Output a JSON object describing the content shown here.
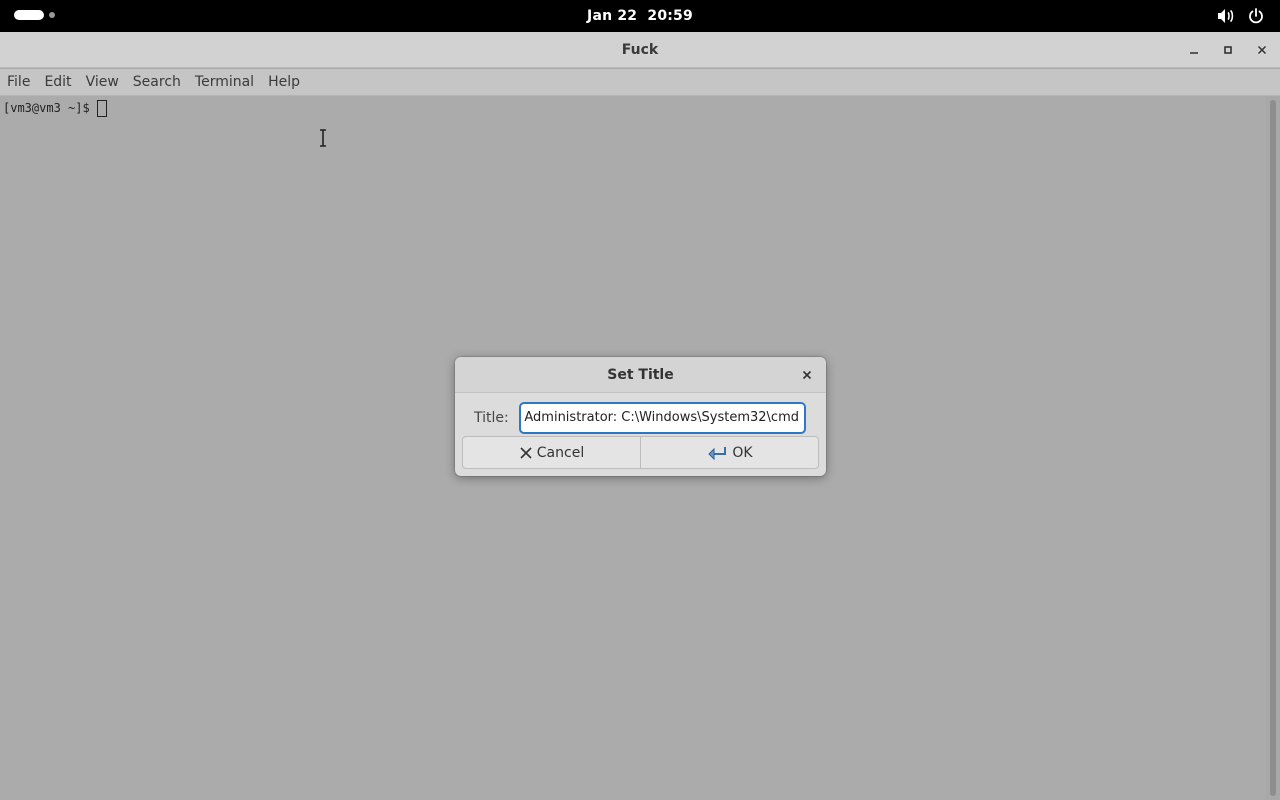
{
  "topbar": {
    "date": "Jan 22",
    "time": "20:59",
    "icons": [
      "activities-indicator",
      "volume-icon",
      "power-icon"
    ]
  },
  "window": {
    "title": "Fuck",
    "menu": [
      "File",
      "Edit",
      "View",
      "Search",
      "Terminal",
      "Help"
    ],
    "prompt": "[vm3@vm3 ~]$"
  },
  "dialog": {
    "title": "Set Title",
    "label": "Title:",
    "value": "Administrator: C:\\Windows\\System32\\cmd",
    "cancel_label": "Cancel",
    "ok_label": "OK"
  },
  "colors": {
    "accent": "#2f77c4",
    "terminal_bg": "#ababab",
    "topbar_bg": "#000000"
  }
}
